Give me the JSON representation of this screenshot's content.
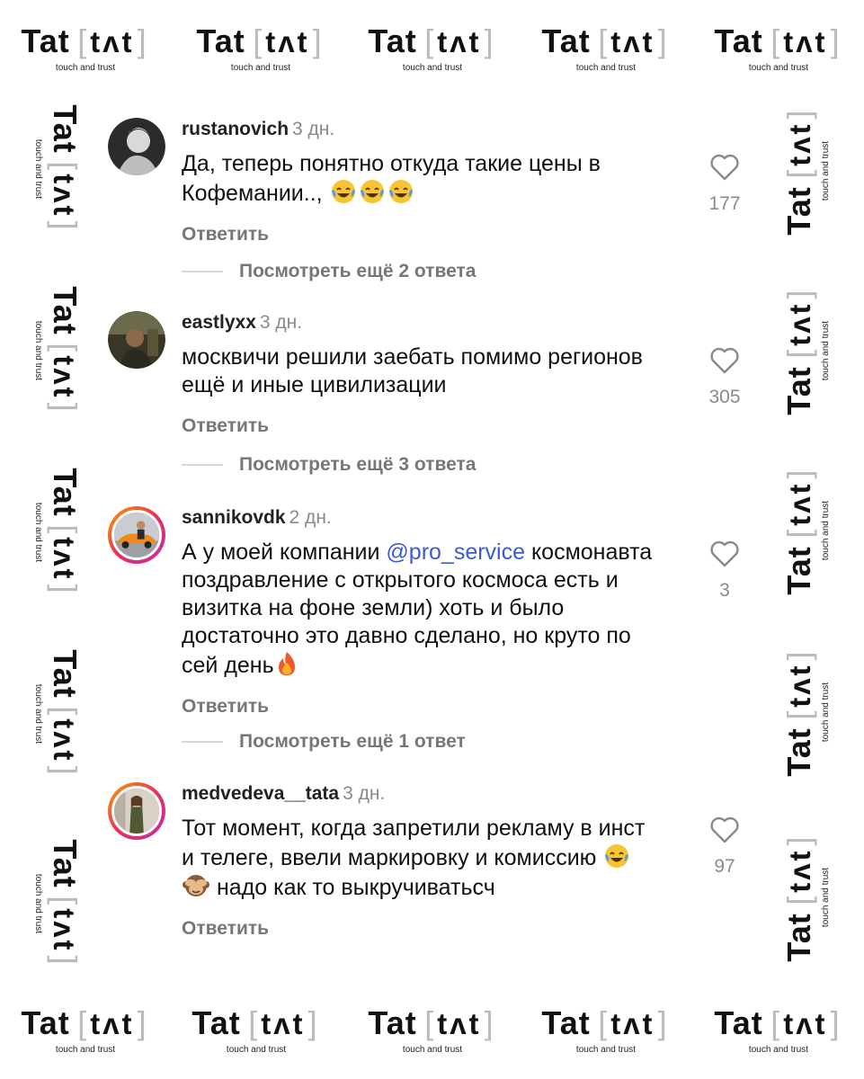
{
  "brand": {
    "name": "Tat",
    "bracket_open": "[",
    "phonetic": "tʌt",
    "bracket_close": "]",
    "tagline": "touch and trust"
  },
  "comments": [
    {
      "username": "rustanovich",
      "time": "3 дн.",
      "text": "Да, теперь понятно откуда такие цены в Кофемании..,",
      "likes": "177",
      "reply_label": "Ответить",
      "more_replies": "Посмотреть ещё 2 ответа",
      "avatar_icon": "bw-portrait-avatar"
    },
    {
      "username": "eastlyxx",
      "time": "3 дн.",
      "text": "москвичи решили заебать помимо регионов ещё и иные цивилизации",
      "likes": "305",
      "reply_label": "Ответить",
      "more_replies": "Посмотреть ещё 3 ответа",
      "avatar_icon": "dark-photo-avatar"
    },
    {
      "username": "sannikovdk",
      "time": "2 дн.",
      "text_before": "А у моей компании ",
      "mention": "@pro_service",
      "text_after": " космонавта поздравление с открытого космоса есть и визитка на фоне земли) хоть и было достаточно это давно сделано, но круто по сей день",
      "likes": "3",
      "reply_label": "Ответить",
      "more_replies": "Посмотреть ещё 1 ответ",
      "avatar_icon": "orange-car-avatar"
    },
    {
      "username": "medvedeva__tata",
      "time": "3 дн.",
      "text_before": "Тот момент, когда запретили рекламу в инст и телеге, ввели маркировку и комиссию ",
      "text_after": " надо как то выкручиватьсч",
      "likes": "97",
      "reply_label": "Ответить",
      "avatar_icon": "woman-photo-avatar"
    }
  ],
  "colors": {
    "mention": "#3b5bd3",
    "muted": "#8a8a8a",
    "story_ring_start": "#f6a400",
    "story_ring_end": "#c02bb0"
  }
}
